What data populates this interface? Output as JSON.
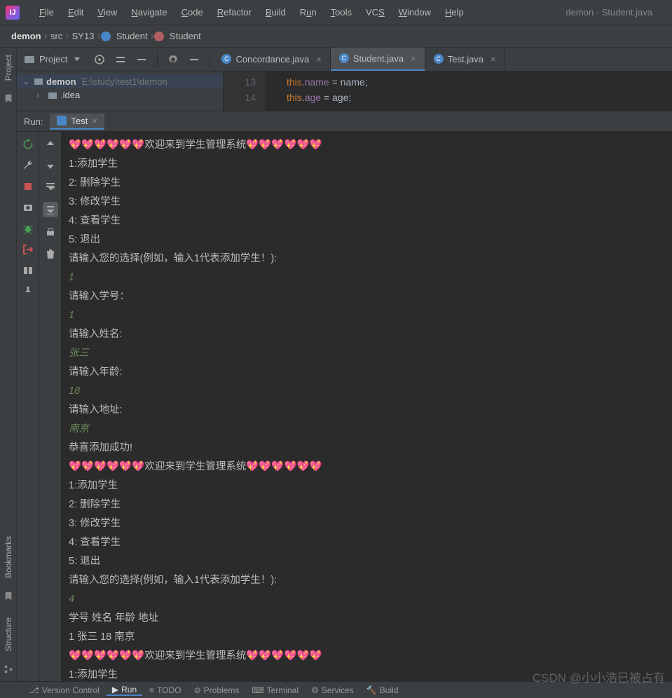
{
  "window_title": "demon - Student.java",
  "menu": [
    "File",
    "Edit",
    "View",
    "Navigate",
    "Code",
    "Refactor",
    "Build",
    "Run",
    "Tools",
    "VCS",
    "Window",
    "Help"
  ],
  "menu_underline_idx": [
    0,
    0,
    0,
    0,
    0,
    0,
    0,
    1,
    0,
    2,
    0,
    0
  ],
  "breadcrumb": {
    "project": "demon",
    "items": [
      "src",
      "SY13"
    ],
    "class_item": "Student",
    "method_item": "Student"
  },
  "project_panel": {
    "title": "Project",
    "root": "demon",
    "root_path": "E:\\study\\test1\\demon",
    "child": ".idea"
  },
  "tabs": [
    {
      "name": "Concordance.java",
      "active": false
    },
    {
      "name": "Student.java",
      "active": true
    },
    {
      "name": "Test.java",
      "active": false
    }
  ],
  "code": {
    "lines": [
      {
        "n": "13",
        "prefix": "this",
        "dot1": ".",
        "field": "name",
        "rest": " = name;"
      },
      {
        "n": "14",
        "prefix": "this",
        "dot1": ".",
        "field": "age",
        "rest": " = age;"
      }
    ]
  },
  "run": {
    "label": "Run:",
    "tab": "Test"
  },
  "console": [
    {
      "t": "hearts",
      "text": "欢迎来到学生管理系统"
    },
    {
      "t": "plain",
      "text": "1:添加学生"
    },
    {
      "t": "plain",
      "text": "2: 删除学生"
    },
    {
      "t": "plain",
      "text": "3: 修改学生"
    },
    {
      "t": "plain",
      "text": "4: 查看学生"
    },
    {
      "t": "plain",
      "text": "5: 退出"
    },
    {
      "t": "plain",
      "text": "请输入您的选择(例如，输入1代表添加学生！):"
    },
    {
      "t": "input",
      "text": "1"
    },
    {
      "t": "plain",
      "text": "请输入学号："
    },
    {
      "t": "input",
      "text": "1"
    },
    {
      "t": "plain",
      "text": "请输入姓名:"
    },
    {
      "t": "input",
      "text": "张三"
    },
    {
      "t": "plain",
      "text": "请输入年龄:"
    },
    {
      "t": "input",
      "text": "18"
    },
    {
      "t": "plain",
      "text": "请输入地址:"
    },
    {
      "t": "input",
      "text": "南京"
    },
    {
      "t": "plain",
      "text": "恭喜添加成功!"
    },
    {
      "t": "hearts",
      "text": "欢迎来到学生管理系统"
    },
    {
      "t": "plain",
      "text": "1:添加学生"
    },
    {
      "t": "plain",
      "text": "2: 删除学生"
    },
    {
      "t": "plain",
      "text": "3: 修改学生"
    },
    {
      "t": "plain",
      "text": "4: 查看学生"
    },
    {
      "t": "plain",
      "text": "5: 退出"
    },
    {
      "t": "plain",
      "text": "请输入您的选择(例如，输入1代表添加学生！):"
    },
    {
      "t": "input",
      "text": "4"
    },
    {
      "t": "plain",
      "text": "学号      姓名       年龄       地址"
    },
    {
      "t": "plain",
      "text": "1         张三       18         南京"
    },
    {
      "t": "hearts",
      "text": "欢迎来到学生管理系统"
    },
    {
      "t": "plain",
      "text": "1:添加学生"
    }
  ],
  "sidebars": {
    "left": [
      "Project",
      "Bookmarks",
      "Structure"
    ]
  },
  "bottom": [
    "Version Control",
    "Run",
    "TODO",
    "Problems",
    "Terminal",
    "Services",
    "Build"
  ],
  "watermark": "CSDN @小小浩已被占有"
}
